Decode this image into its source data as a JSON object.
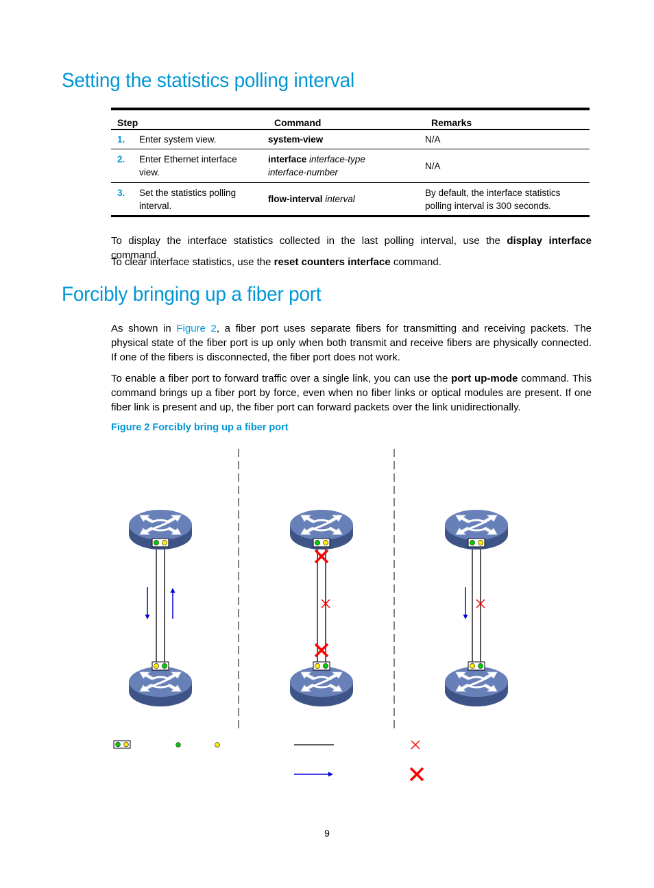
{
  "section1": {
    "title": "Setting the statistics polling interval",
    "table": {
      "headers": [
        "Step",
        "Command",
        "Remarks"
      ],
      "rows": [
        {
          "num": "1.",
          "step": "Enter system view.",
          "cmd_bold": "system-view",
          "cmd_italic": "",
          "remarks": "N/A"
        },
        {
          "num": "2.",
          "step": "Enter Ethernet interface view.",
          "cmd_bold": "interface",
          "cmd_italic": "interface-type interface-number",
          "remarks": "N/A"
        },
        {
          "num": "3.",
          "step": "Set the statistics polling interval.",
          "cmd_bold": "flow-interval",
          "cmd_italic": "interval",
          "remarks": "By default, the interface statistics polling interval is 300 seconds."
        }
      ]
    },
    "para1": {
      "pre": "To display the interface statistics collected in the last polling interval, use the ",
      "bold": "display interface",
      "post": " command."
    },
    "para2": {
      "pre": "To clear interface statistics, use the ",
      "bold": "reset counters interface",
      "post": " command."
    }
  },
  "section2": {
    "title": "Forcibly bringing up a fiber port",
    "para1": {
      "pre": "As shown in ",
      "link": "Figure 2",
      "post": ", a fiber port uses separate fibers for transmitting and receiving packets. The physical state of the fiber port is up only when both transmit and receive fibers are physically connected. If one of the fibers is disconnected, the fiber port does not work."
    },
    "para2": {
      "pre": "To enable a fiber port to forward traffic over a single link, you can use the ",
      "bold": "port up-mode",
      "post": " command. This command brings up a fiber port by force, even when no fiber links or optical modules are present. If one fiber link is present and up, the fiber port can forward packets over the link unidirectionally."
    },
    "figure_caption": "Figure 2 Forcibly bring up a fiber port"
  },
  "figure": {
    "colors": {
      "device": "#5b73a8",
      "device_dark": "#3f5486",
      "port_tx": "#00cc00",
      "port_rx": "#ffee00",
      "fiber": "#000000",
      "traffic": "#0000dd",
      "broken": "#ff0000"
    },
    "scenarios": [
      {
        "name": "both-fibers-connected",
        "left_fiber": "up",
        "right_fiber": "up",
        "traffic": [
          "down",
          "up"
        ]
      },
      {
        "name": "no-fiber-or-module",
        "left_fiber": "no-module",
        "right_fiber": "broken",
        "traffic": []
      },
      {
        "name": "single-fiber-up",
        "left_fiber": "up",
        "right_fiber": "broken",
        "traffic": [
          "down"
        ]
      }
    ],
    "legend": [
      "fiber-port",
      "transmit-port",
      "receive-port",
      "fiber-link",
      "traffic-direction",
      "fiber-disconnected",
      "no-fiber-or-module"
    ]
  },
  "page_number": "9"
}
